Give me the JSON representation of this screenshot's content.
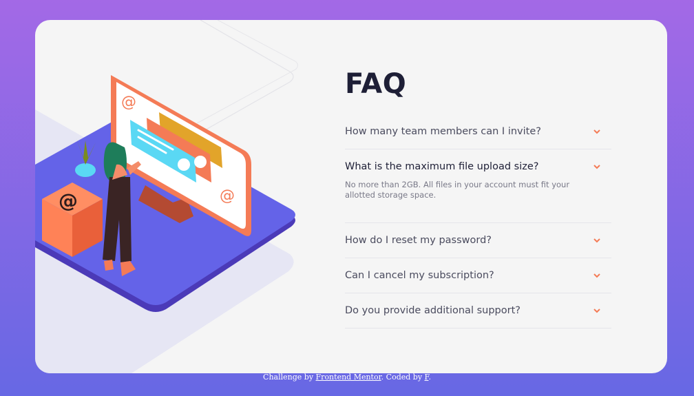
{
  "faq": {
    "title": "FAQ",
    "items": [
      {
        "question": "How many team members can I invite?",
        "open": false
      },
      {
        "question": "What is the maximum file upload size?",
        "open": true,
        "answer": "No more than 2GB. All files in your account must fit your allotted storage space."
      },
      {
        "question": "How do I reset my password?",
        "open": false
      },
      {
        "question": "Can I cancel my subscription?",
        "open": false
      },
      {
        "question": "Do you provide additional support?",
        "open": false
      }
    ]
  },
  "footer": {
    "prefix": "Challenge by ",
    "link1": "Frontend Mentor",
    "middle": ". Coded by ",
    "link2": "F",
    "suffix": "."
  },
  "icons": {
    "chevron": "chevron-down-icon",
    "illustration": "woman-online-illustration",
    "box": "box-at-icon"
  },
  "colors": {
    "title": "#1e1f36",
    "question": "#4a4b5e",
    "answer": "#787887",
    "chevron": "#f47b56",
    "bg_top": "#a369e6",
    "bg_bottom": "#6768e4",
    "card": "#f5f5f5"
  }
}
